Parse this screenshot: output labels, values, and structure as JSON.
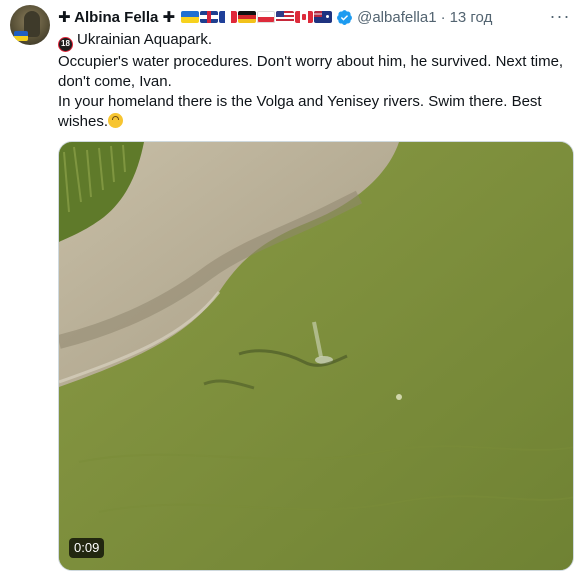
{
  "tweet": {
    "author": {
      "display_name": "✚ Albina Fella ✚",
      "flags": [
        "flag-ukraine",
        "flag-united-kingdom",
        "flag-france",
        "flag-germany",
        "flag-poland",
        "flag-united-states",
        "flag-canada",
        "flag-australia"
      ],
      "verified_icon": "verified-badge-icon",
      "handle": "@albafella1",
      "separator": "·",
      "time": "13 год"
    },
    "more_label": "···",
    "text": {
      "line1": "Ukrainian Aquapark.",
      "line2": "Occupier's water procedures. Don't worry about him, he survived. Next time, don't come, Ivan.",
      "line3": "In your homeland there is the Volga and Yenisey rivers. Swim there. Best wishes."
    },
    "media": {
      "type": "video",
      "duration": "0:09"
    }
  },
  "colors": {
    "verified_blue": "#1d9bf0",
    "secondary_text": "#536471",
    "water": "#7f8f3c",
    "shore": "#b8ad95"
  }
}
